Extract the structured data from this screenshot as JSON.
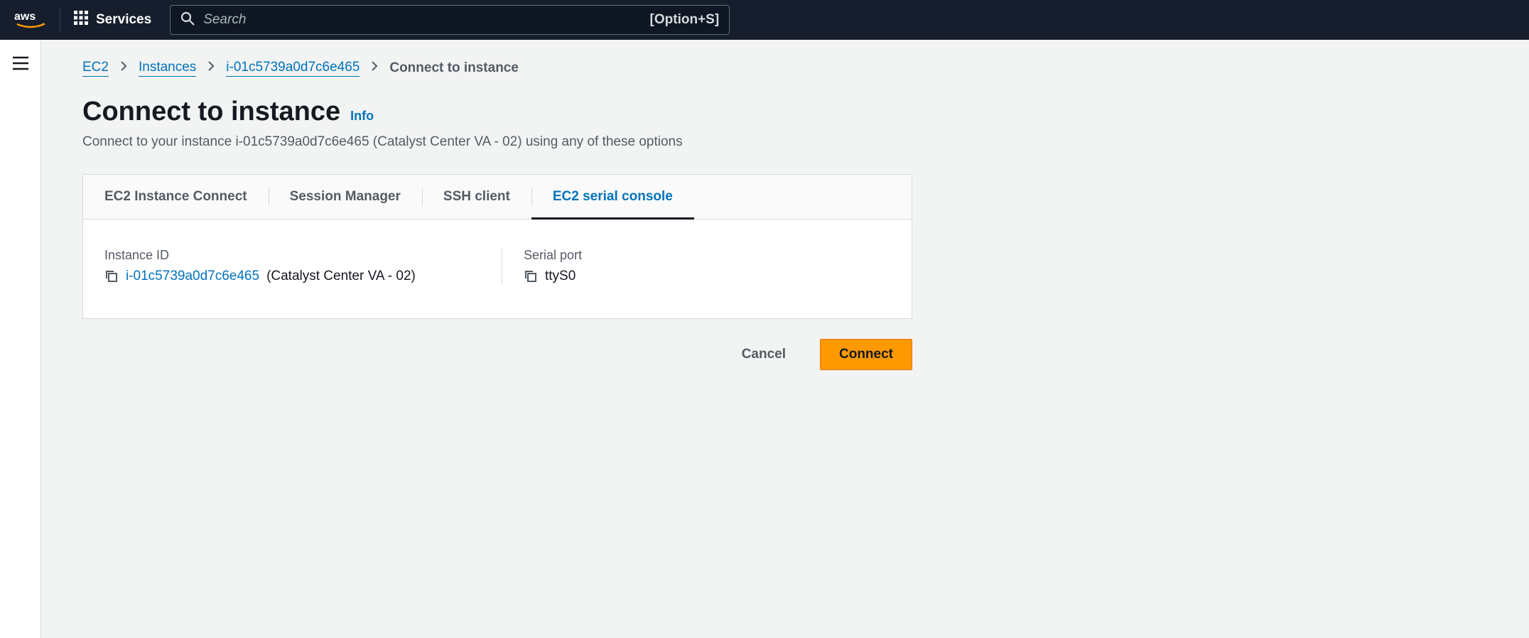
{
  "nav": {
    "services_label": "Services",
    "search_placeholder": "Search",
    "search_shortcut": "[Option+S]"
  },
  "breadcrumb": {
    "items": [
      {
        "label": "EC2"
      },
      {
        "label": "Instances"
      },
      {
        "label": "i-01c5739a0d7c6e465"
      }
    ],
    "current": "Connect to instance"
  },
  "page": {
    "title": "Connect to instance",
    "info_label": "Info",
    "subtitle": "Connect to your instance i-01c5739a0d7c6e465 (Catalyst Center VA - 02) using any of these options"
  },
  "tabs": [
    {
      "label": "EC2 Instance Connect"
    },
    {
      "label": "Session Manager"
    },
    {
      "label": "SSH client"
    },
    {
      "label": "EC2 serial console"
    }
  ],
  "details": {
    "instance_id_label": "Instance ID",
    "instance_id_value": "i-01c5739a0d7c6e465",
    "instance_id_name": "(Catalyst Center VA - 02)",
    "serial_port_label": "Serial port",
    "serial_port_value": "ttyS0"
  },
  "footer": {
    "cancel": "Cancel",
    "connect": "Connect"
  }
}
